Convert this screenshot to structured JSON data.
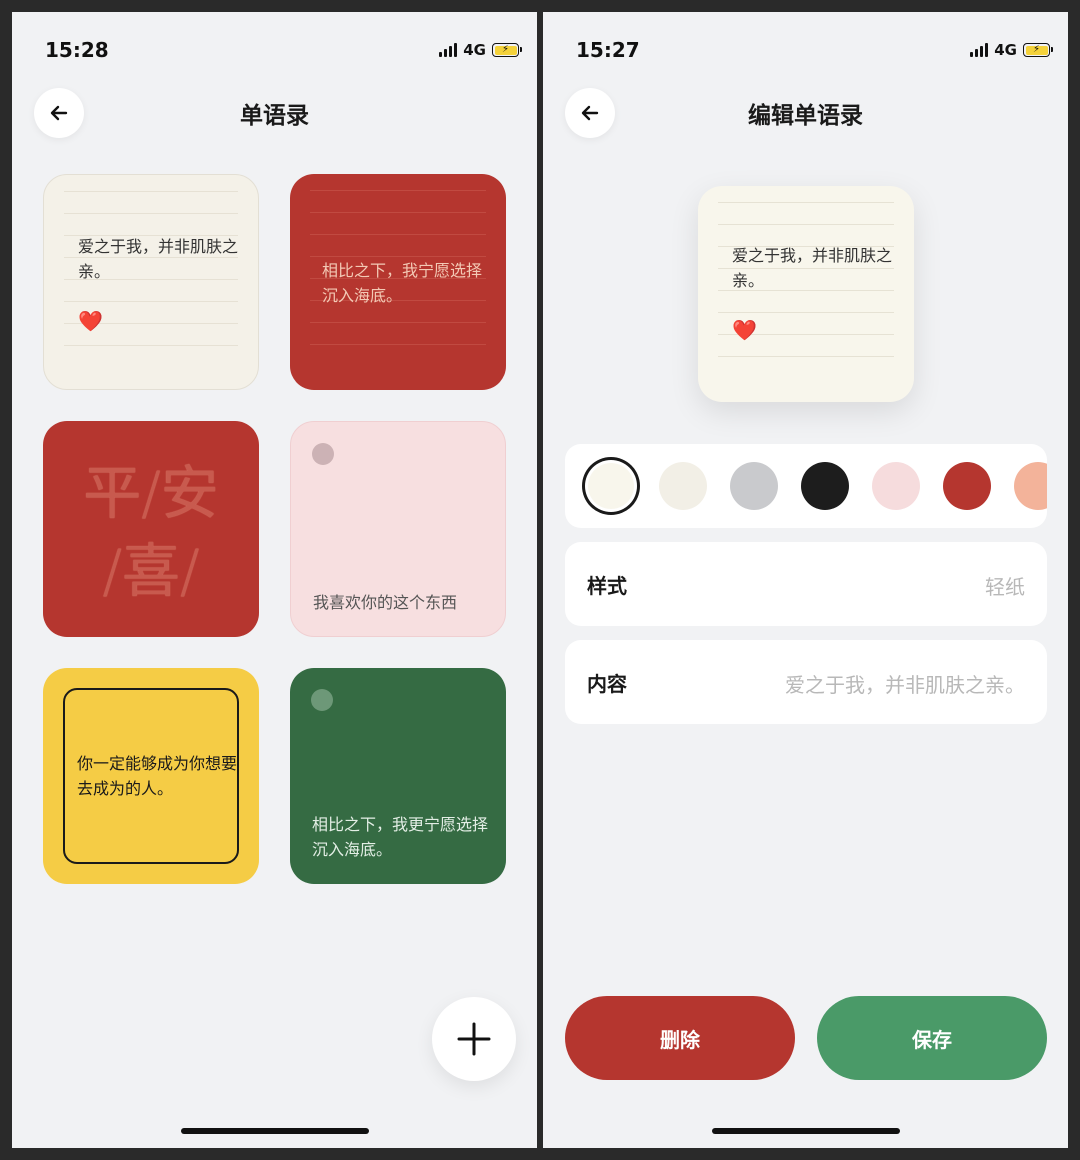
{
  "left_screen": {
    "status": {
      "time": "15:28",
      "network": "4G"
    },
    "title": "单语录",
    "cards": [
      {
        "text": "爱之于我，并非肌肤之亲。",
        "emoji": "❤️"
      },
      {
        "text": "相比之下，我宁愿选择沉入海底。"
      },
      {
        "line1": "平/安",
        "line2": "/喜/"
      },
      {
        "text": "我喜欢你的这个东西"
      },
      {
        "text": "你一定能够成为你想要去成为的人。"
      },
      {
        "text": "相比之下，我更宁愿选择沉入海底。"
      }
    ],
    "fab_icon": "plus-icon"
  },
  "right_screen": {
    "status": {
      "time": "15:27",
      "network": "4G"
    },
    "title": "编辑单语录",
    "preview": {
      "text": "爱之于我，并非肌肤之亲。",
      "emoji": "❤️"
    },
    "swatches": [
      "#f8f6ec",
      "#f2efe6",
      "#c9cacd",
      "#1d1d1d",
      "#f6dcdd",
      "#b5362f",
      "#f3b39a"
    ],
    "selected_swatch": 0,
    "style": {
      "label": "样式",
      "value": "轻纸"
    },
    "content": {
      "label": "内容",
      "value": "爱之于我，并非肌肤之亲。"
    },
    "delete_label": "删除",
    "save_label": "保存",
    "colors": {
      "delete": "#b5362f",
      "save": "#4a9a68"
    }
  }
}
